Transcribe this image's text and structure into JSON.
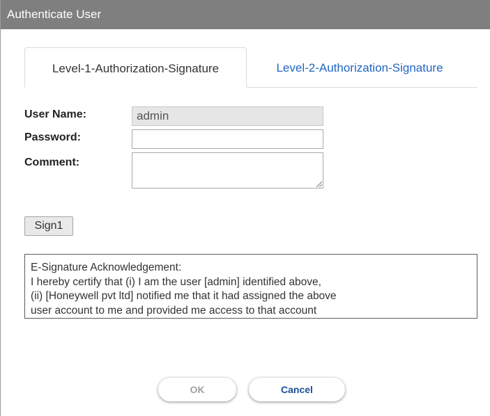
{
  "dialog": {
    "title": "Authenticate User"
  },
  "tabs": [
    {
      "label": "Level-1-Authorization-Signature",
      "active": true
    },
    {
      "label": "Level-2-Authorization-Signature",
      "active": false
    }
  ],
  "form": {
    "username_label": "User Name:",
    "username_value": "admin",
    "password_label": "Password:",
    "password_value": "",
    "comment_label": "Comment:",
    "comment_value": ""
  },
  "sign_button": "Sign1",
  "acknowledgement": {
    "lines": [
      "E-Signature Acknowledgement:",
      "I hereby certify that (i) I am the user [admin] identified above,",
      "(ii) [Honeywell pvt ltd] notified me that it had assigned the above",
      "user account to me and provided me access to that account"
    ]
  },
  "buttons": {
    "ok": "OK",
    "cancel": "Cancel"
  },
  "colors": {
    "titlebar": "#7f7f7f",
    "link_tab": "#2266c2",
    "cancel_text": "#1d4f9a",
    "ok_disabled_text": "#a0a0a0"
  }
}
